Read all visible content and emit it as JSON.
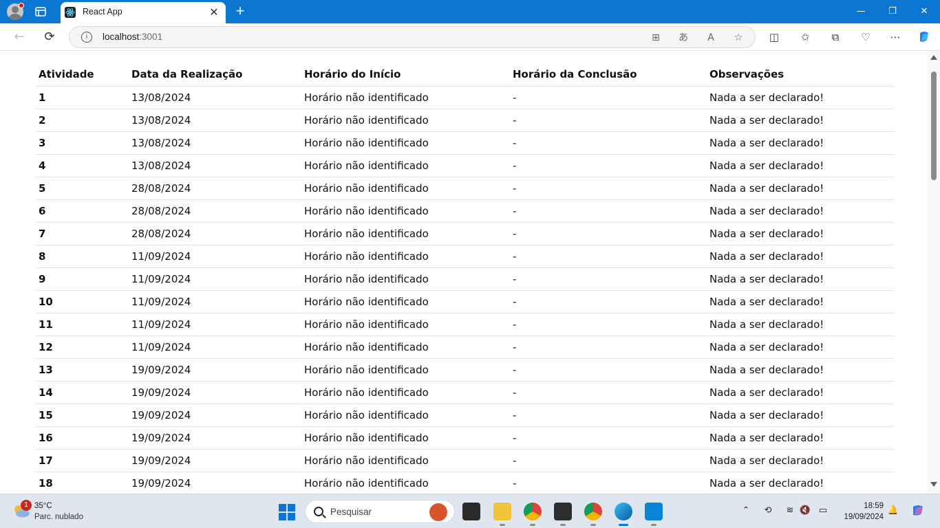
{
  "browser": {
    "tab_title": "React App",
    "url_host": "localhost",
    "url_port": ":3001"
  },
  "table": {
    "headers": [
      "Atividade",
      "Data da Realização",
      "Horário do Início",
      "Horário da Conclusão",
      "Observações"
    ],
    "rows": [
      {
        "atividade": "1",
        "data": "13/08/2024",
        "inicio": "Horário não identificado",
        "conclusao": "-",
        "obs": "Nada a ser declarado!"
      },
      {
        "atividade": "2",
        "data": "13/08/2024",
        "inicio": "Horário não identificado",
        "conclusao": "-",
        "obs": "Nada a ser declarado!"
      },
      {
        "atividade": "3",
        "data": "13/08/2024",
        "inicio": "Horário não identificado",
        "conclusao": "-",
        "obs": "Nada a ser declarado!"
      },
      {
        "atividade": "4",
        "data": "13/08/2024",
        "inicio": "Horário não identificado",
        "conclusao": "-",
        "obs": "Nada a ser declarado!"
      },
      {
        "atividade": "5",
        "data": "28/08/2024",
        "inicio": "Horário não identificado",
        "conclusao": "-",
        "obs": "Nada a ser declarado!"
      },
      {
        "atividade": "6",
        "data": "28/08/2024",
        "inicio": "Horário não identificado",
        "conclusao": "-",
        "obs": "Nada a ser declarado!"
      },
      {
        "atividade": "7",
        "data": "28/08/2024",
        "inicio": "Horário não identificado",
        "conclusao": "-",
        "obs": "Nada a ser declarado!"
      },
      {
        "atividade": "8",
        "data": "11/09/2024",
        "inicio": "Horário não identificado",
        "conclusao": "-",
        "obs": "Nada a ser declarado!"
      },
      {
        "atividade": "9",
        "data": "11/09/2024",
        "inicio": "Horário não identificado",
        "conclusao": "-",
        "obs": "Nada a ser declarado!"
      },
      {
        "atividade": "10",
        "data": "11/09/2024",
        "inicio": "Horário não identificado",
        "conclusao": "-",
        "obs": "Nada a ser declarado!"
      },
      {
        "atividade": "11",
        "data": "11/09/2024",
        "inicio": "Horário não identificado",
        "conclusao": "-",
        "obs": "Nada a ser declarado!"
      },
      {
        "atividade": "12",
        "data": "11/09/2024",
        "inicio": "Horário não identificado",
        "conclusao": "-",
        "obs": "Nada a ser declarado!"
      },
      {
        "atividade": "13",
        "data": "19/09/2024",
        "inicio": "Horário não identificado",
        "conclusao": "-",
        "obs": "Nada a ser declarado!"
      },
      {
        "atividade": "14",
        "data": "19/09/2024",
        "inicio": "Horário não identificado",
        "conclusao": "-",
        "obs": "Nada a ser declarado!"
      },
      {
        "atividade": "15",
        "data": "19/09/2024",
        "inicio": "Horário não identificado",
        "conclusao": "-",
        "obs": "Nada a ser declarado!"
      },
      {
        "atividade": "16",
        "data": "19/09/2024",
        "inicio": "Horário não identificado",
        "conclusao": "-",
        "obs": "Nada a ser declarado!"
      },
      {
        "atividade": "17",
        "data": "19/09/2024",
        "inicio": "Horário não identificado",
        "conclusao": "-",
        "obs": "Nada a ser declarado!"
      },
      {
        "atividade": "18",
        "data": "19/09/2024",
        "inicio": "Horário não identificado",
        "conclusao": "-",
        "obs": "Nada a ser declarado!"
      }
    ]
  },
  "taskbar": {
    "weather_temp": "35°C",
    "weather_cond": "Parc. nublado",
    "weather_badge": "1",
    "search_placeholder": "Pesquisar",
    "time": "18:59",
    "date": "19/09/2024"
  },
  "colors": {
    "titlebar": "#0b77d2",
    "taskbar": "#dfe6f0",
    "row_border": "#dee2e6"
  }
}
